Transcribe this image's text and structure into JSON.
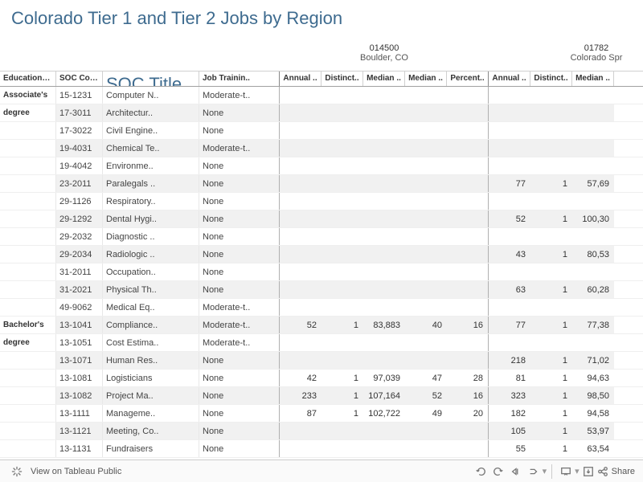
{
  "page_title": "Colorado Tier 1 and Tier 2 Jobs by Region",
  "columns": {
    "row_headers": [
      "Education V..",
      "SOC Code",
      "SOC Title",
      "Job Trainin.."
    ],
    "data_headers": [
      "Annual ..",
      "Distinct..",
      "Median ..",
      "Median ..",
      "Percent.."
    ]
  },
  "regions": [
    {
      "code": "014500",
      "name": "Boulder, CO"
    },
    {
      "code": "01782",
      "name": "Colorado Spr"
    }
  ],
  "groups": [
    {
      "education": "Associate's degree",
      "rows": [
        {
          "soc": "15-1231",
          "title": "Computer N..",
          "training": "Moderate-t..",
          "r1": [
            "",
            "",
            "",
            "",
            ""
          ],
          "r2": [
            "",
            "",
            ""
          ],
          "alt": false
        },
        {
          "soc": "17-3011",
          "title": "Architectur..",
          "training": "None",
          "r1": [
            "",
            "",
            "",
            "",
            ""
          ],
          "r2": [
            "",
            "",
            ""
          ],
          "alt": true
        },
        {
          "soc": "17-3022",
          "title": "Civil Engine..",
          "training": "None",
          "r1": [
            "",
            "",
            "",
            "",
            ""
          ],
          "r2": [
            "",
            "",
            ""
          ],
          "alt": false
        },
        {
          "soc": "19-4031",
          "title": "Chemical Te..",
          "training": "Moderate-t..",
          "r1": [
            "",
            "",
            "",
            "",
            ""
          ],
          "r2": [
            "",
            "",
            ""
          ],
          "alt": true
        },
        {
          "soc": "19-4042",
          "title": "Environme..",
          "training": "None",
          "r1": [
            "",
            "",
            "",
            "",
            ""
          ],
          "r2": [
            "",
            "",
            ""
          ],
          "alt": false
        },
        {
          "soc": "23-2011",
          "title": "Paralegals ..",
          "training": "None",
          "r1": [
            "",
            "",
            "",
            "",
            ""
          ],
          "r2": [
            "77",
            "1",
            "57,69"
          ],
          "alt": true
        },
        {
          "soc": "29-1126",
          "title": "Respiratory..",
          "training": "None",
          "r1": [
            "",
            "",
            "",
            "",
            ""
          ],
          "r2": [
            "",
            "",
            ""
          ],
          "alt": false
        },
        {
          "soc": "29-1292",
          "title": "Dental Hygi..",
          "training": "None",
          "r1": [
            "",
            "",
            "",
            "",
            ""
          ],
          "r2": [
            "52",
            "1",
            "100,30"
          ],
          "alt": true
        },
        {
          "soc": "29-2032",
          "title": "Diagnostic ..",
          "training": "None",
          "r1": [
            "",
            "",
            "",
            "",
            ""
          ],
          "r2": [
            "",
            "",
            ""
          ],
          "alt": false
        },
        {
          "soc": "29-2034",
          "title": "Radiologic ..",
          "training": "None",
          "r1": [
            "",
            "",
            "",
            "",
            ""
          ],
          "r2": [
            "43",
            "1",
            "80,53"
          ],
          "alt": true
        },
        {
          "soc": "31-2011",
          "title": "Occupation..",
          "training": "None",
          "r1": [
            "",
            "",
            "",
            "",
            ""
          ],
          "r2": [
            "",
            "",
            ""
          ],
          "alt": false
        },
        {
          "soc": "31-2021",
          "title": "Physical Th..",
          "training": "None",
          "r1": [
            "",
            "",
            "",
            "",
            ""
          ],
          "r2": [
            "63",
            "1",
            "60,28"
          ],
          "alt": true
        },
        {
          "soc": "49-9062",
          "title": "Medical Eq..",
          "training": "Moderate-t..",
          "r1": [
            "",
            "",
            "",
            "",
            ""
          ],
          "r2": [
            "",
            "",
            ""
          ],
          "alt": false
        }
      ]
    },
    {
      "education": "Bachelor's degree",
      "rows": [
        {
          "soc": "13-1041",
          "title": "Compliance..",
          "training": "Moderate-t..",
          "r1": [
            "52",
            "1",
            "83,883",
            "40",
            "16"
          ],
          "r2": [
            "77",
            "1",
            "77,38"
          ],
          "alt": true
        },
        {
          "soc": "13-1051",
          "title": "Cost Estima..",
          "training": "Moderate-t..",
          "r1": [
            "",
            "",
            "",
            "",
            ""
          ],
          "r2": [
            "",
            "",
            ""
          ],
          "alt": false
        },
        {
          "soc": "13-1071",
          "title": "Human Res..",
          "training": "None",
          "r1": [
            "",
            "",
            "",
            "",
            ""
          ],
          "r2": [
            "218",
            "1",
            "71,02"
          ],
          "alt": true
        },
        {
          "soc": "13-1081",
          "title": "Logisticians",
          "training": "None",
          "r1": [
            "42",
            "1",
            "97,039",
            "47",
            "28"
          ],
          "r2": [
            "81",
            "1",
            "94,63"
          ],
          "alt": false
        },
        {
          "soc": "13-1082",
          "title": "Project Ma..",
          "training": "None",
          "r1": [
            "233",
            "1",
            "107,164",
            "52",
            "16"
          ],
          "r2": [
            "323",
            "1",
            "98,50"
          ],
          "alt": true
        },
        {
          "soc": "13-1111",
          "title": "Manageme..",
          "training": "None",
          "r1": [
            "87",
            "1",
            "102,722",
            "49",
            "20"
          ],
          "r2": [
            "182",
            "1",
            "94,58"
          ],
          "alt": false
        },
        {
          "soc": "13-1121",
          "title": "Meeting, Co..",
          "training": "None",
          "r1": [
            "",
            "",
            "",
            "",
            ""
          ],
          "r2": [
            "105",
            "1",
            "53,97"
          ],
          "alt": true
        },
        {
          "soc": "13-1131",
          "title": "Fundraisers",
          "training": "None",
          "r1": [
            "",
            "",
            "",
            "",
            ""
          ],
          "r2": [
            "55",
            "1",
            "63,54"
          ],
          "alt": false
        }
      ]
    }
  ],
  "footer": {
    "tableau": "View on Tableau Public",
    "share": "Share"
  }
}
